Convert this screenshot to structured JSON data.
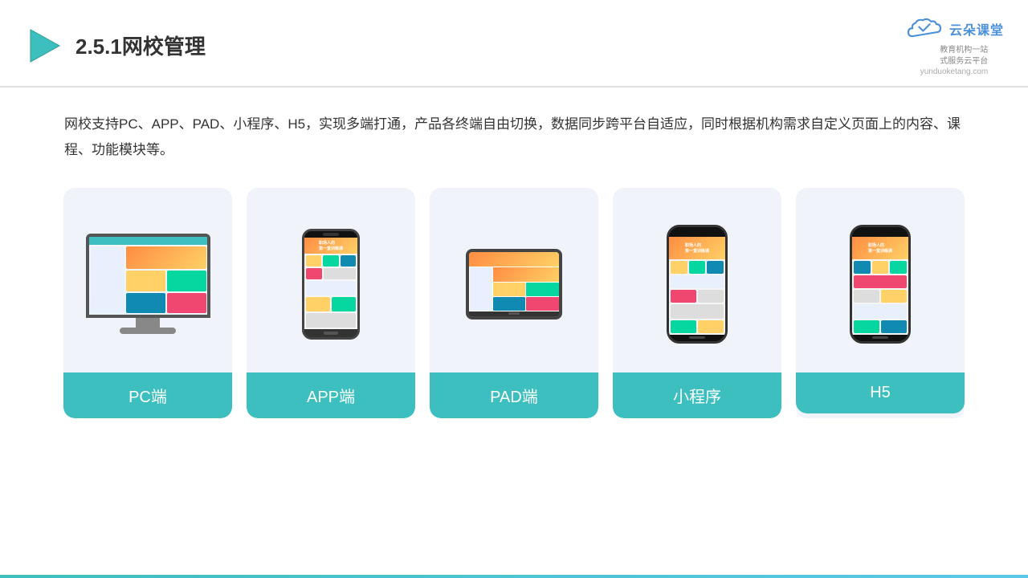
{
  "header": {
    "title": "2.5.1网校管理",
    "logo_cn": "云朵课堂",
    "logo_url": "yunduoketang.com",
    "logo_tagline": "教育机构一站\n式服务云平台"
  },
  "description": {
    "text": "网校支持PC、APP、PAD、小程序、H5，实现多端打通，产品各终端自由切换，数据同步跨平台自适应，同时根据机构需求自定义页面上的内容、课程、功能模块等。"
  },
  "cards": [
    {
      "id": "pc",
      "label": "PC端"
    },
    {
      "id": "app",
      "label": "APP端"
    },
    {
      "id": "pad",
      "label": "PAD端"
    },
    {
      "id": "miniapp",
      "label": "小程序"
    },
    {
      "id": "h5",
      "label": "H5"
    }
  ],
  "colors": {
    "teal": "#3dbfbf",
    "accent": "#4a90d9",
    "border": "#e0e0e0",
    "bg_card": "#f0f4fa"
  }
}
